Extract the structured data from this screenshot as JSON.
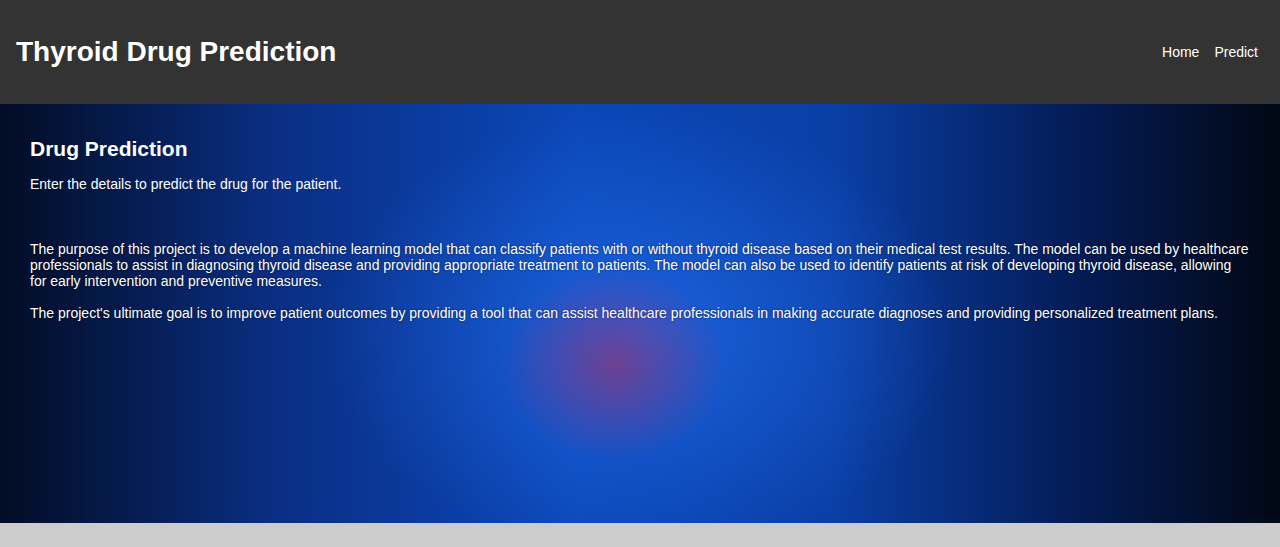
{
  "header": {
    "title": "Thyroid Drug Prediction",
    "nav": [
      {
        "label": "Home"
      },
      {
        "label": "Predict"
      }
    ]
  },
  "hero": {
    "heading": "Drug Prediction",
    "intro": "Enter the details to predict the drug for the patient.",
    "paragraphs": [
      "The purpose of this project is to develop a machine learning model that can classify patients with or without thyroid disease based on their medical test results. The model can be used by healthcare professionals to assist in diagnosing thyroid disease and providing appropriate treatment to patients. The model can also be used to identify patients at risk of developing thyroid disease, allowing for early intervention and preventive measures.",
      "The project's ultimate goal is to improve patient outcomes by providing a tool that can assist healthcare professionals in making accurate diagnoses and providing personalized treatment plans."
    ]
  }
}
